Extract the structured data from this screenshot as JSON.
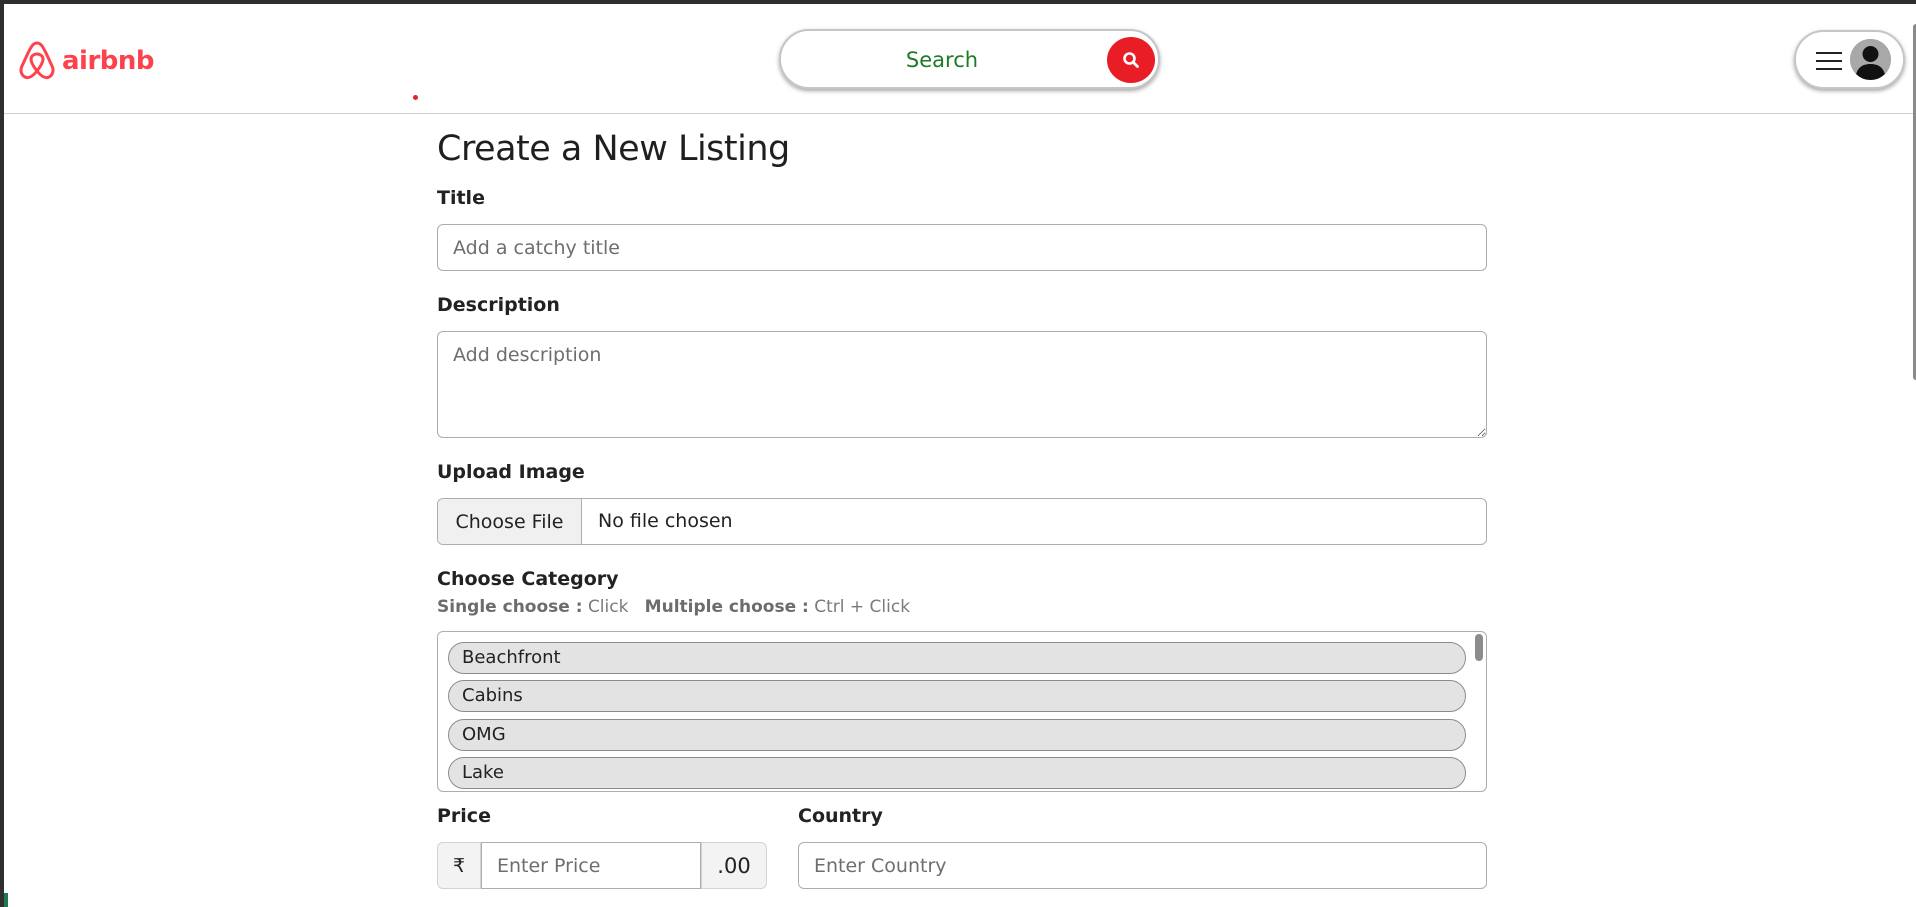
{
  "navbar": {
    "brand_text": "airbnb",
    "brand_icon": "airbnb-logo-icon",
    "search_placeholder": "Search",
    "search_icon": "search-icon",
    "menu_icon": "hamburger-menu-icon",
    "avatar_icon": "user-avatar-icon"
  },
  "colors": {
    "brand": "#fe424d",
    "search_button": "#e81d25",
    "search_text": "#1e7a26"
  },
  "form": {
    "heading": "Create a New Listing",
    "title_label": "Title",
    "title_placeholder": "Add a catchy title",
    "description_label": "Description",
    "description_placeholder": "Add description",
    "image_label": "Upload Image",
    "file_button": "Choose File",
    "file_status": "No file chosen",
    "category_label": "Choose Category",
    "hint_single_label": "Single choose :",
    "hint_single_value": "Click",
    "hint_multi_label": "Multiple choose :",
    "hint_multi_value": "Ctrl + Click",
    "categories": [
      "Beachfront",
      "Cabins",
      "OMG",
      "Lake"
    ],
    "price_label": "Price",
    "currency_symbol": "₹",
    "price_placeholder": "Enter Price",
    "price_suffix": ".00",
    "country_label": "Country",
    "country_placeholder": "Enter Country"
  }
}
